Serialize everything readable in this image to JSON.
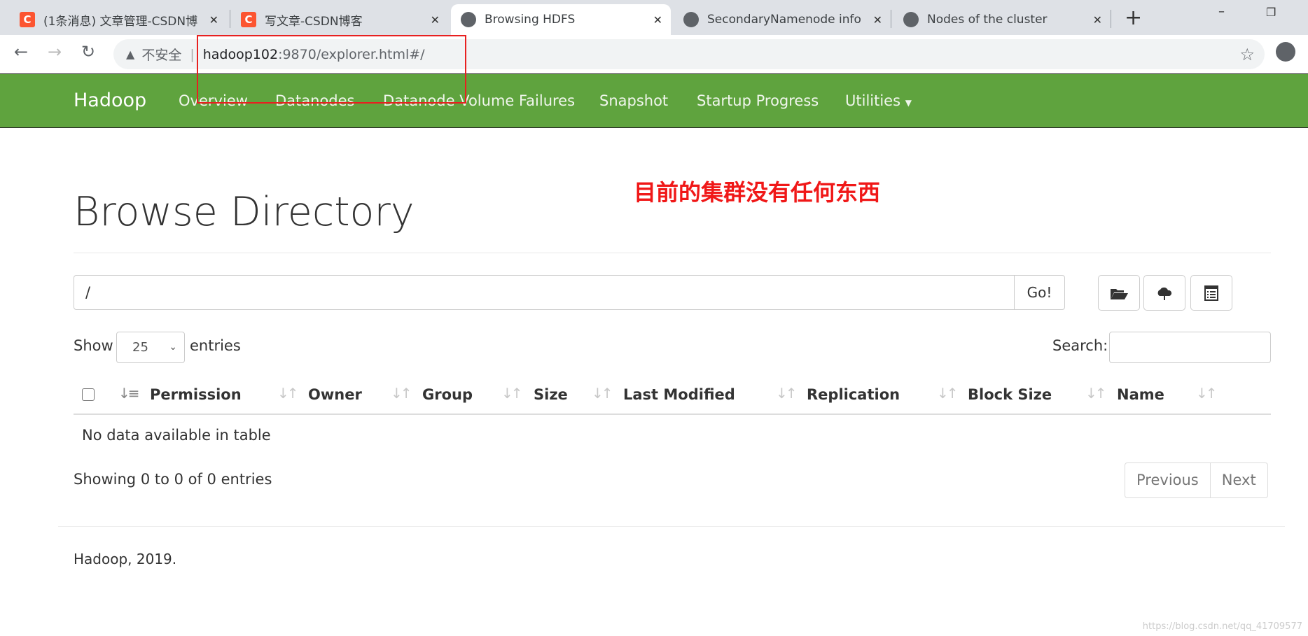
{
  "browser": {
    "tabs": [
      {
        "title": "(1条消息) 文章管理-CSDN博",
        "icon": "csdn-icon"
      },
      {
        "title": "写文章-CSDN博客",
        "icon": "csdn-icon"
      },
      {
        "title": "Browsing HDFS",
        "icon": "globe-icon",
        "active": true
      },
      {
        "title": "SecondaryNamenode info",
        "icon": "globe-icon"
      },
      {
        "title": "Nodes of the cluster",
        "icon": "globe-icon"
      }
    ],
    "security_label": "不安全",
    "url_host": "hadoop102",
    "url_rest": ":9870/explorer.html#/"
  },
  "navbar": {
    "brand": "Hadoop",
    "items": [
      "Overview",
      "Datanodes",
      "Datanode Volume Failures",
      "Snapshot",
      "Startup Progress",
      "Utilities"
    ],
    "color": "#5fa33e"
  },
  "annotation": "目前的集群没有任何东西",
  "page": {
    "title": "Browse Directory",
    "path_value": "/",
    "go_label": "Go!",
    "show_label": "Show",
    "entries_value": "25",
    "entries_label": "entries",
    "search_label": "Search:",
    "columns": [
      "Permission",
      "Owner",
      "Group",
      "Size",
      "Last Modified",
      "Replication",
      "Block Size",
      "Name"
    ],
    "empty_text": "No data available in table",
    "info_text": "Showing 0 to 0 of 0 entries",
    "prev_label": "Previous",
    "next_label": "Next",
    "footer": "Hadoop, 2019."
  },
  "watermark": "https://blog.csdn.net/qq_41709577"
}
